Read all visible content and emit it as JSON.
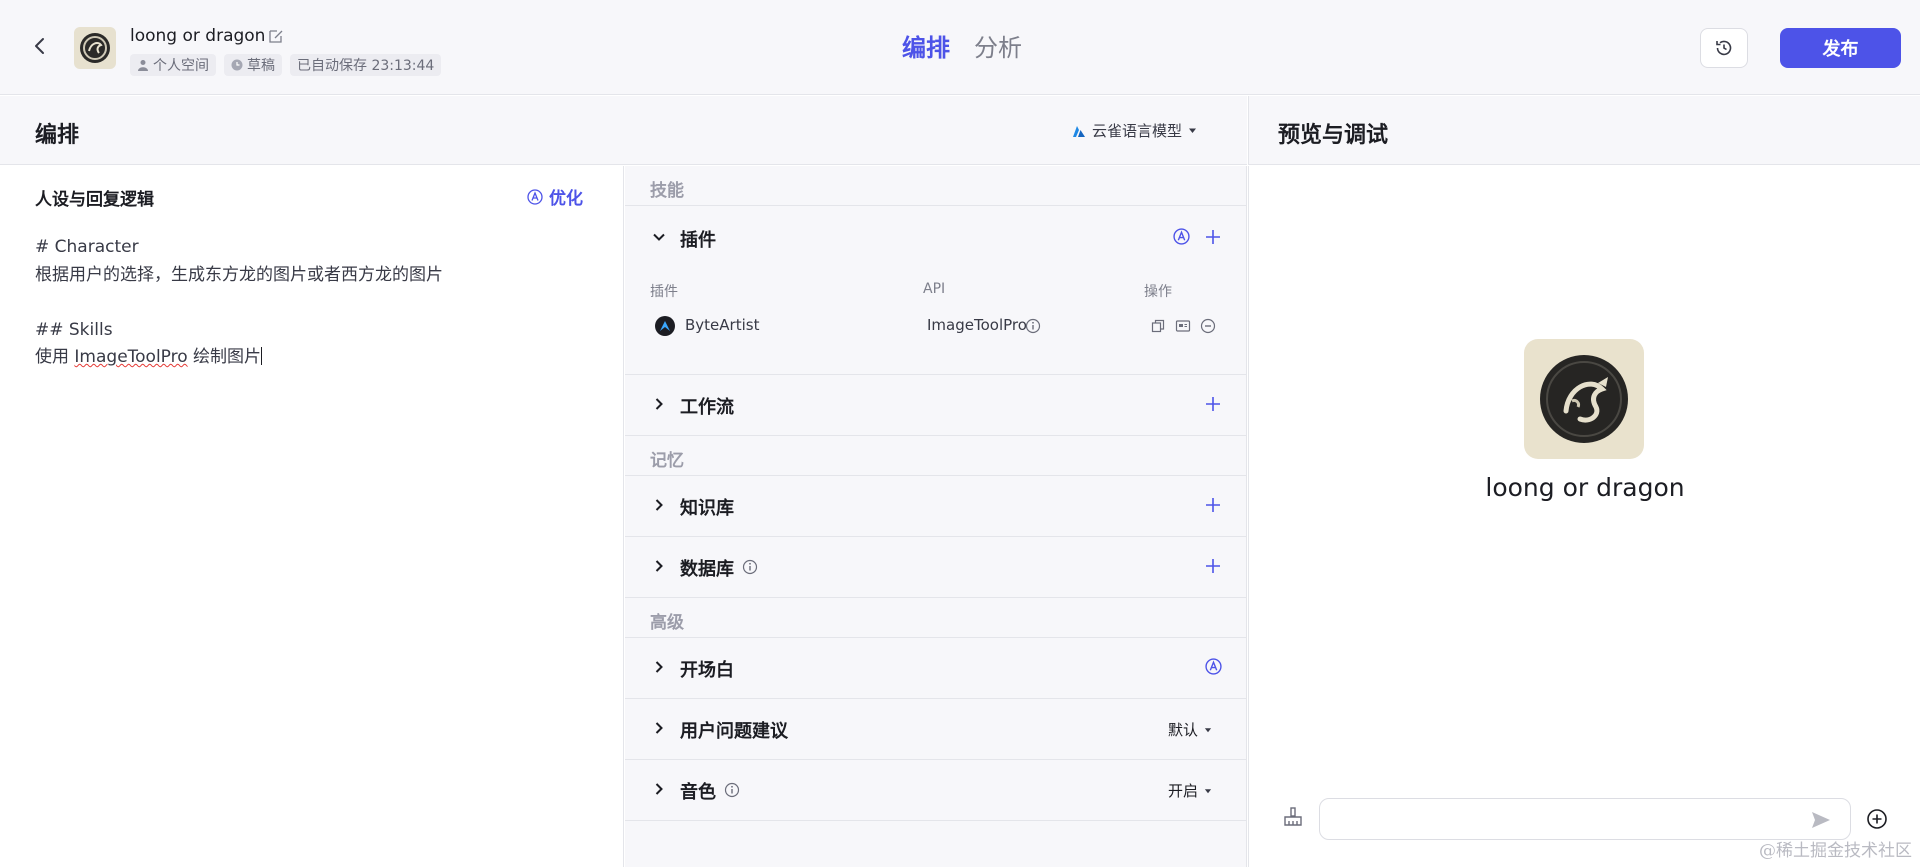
{
  "header": {
    "bot_name": "loong or dragon",
    "meta": {
      "space": "个人空间",
      "status": "草稿",
      "autosave": "已自动保存 23:13:44"
    },
    "tabs": [
      {
        "label": "编排",
        "active": true
      },
      {
        "label": "分析",
        "active": false
      }
    ],
    "publish_label": "发布",
    "accent_color": "#4d53e8"
  },
  "arrange": {
    "title": "编排",
    "model": "云雀语言模型"
  },
  "prompt": {
    "title": "人设与回复逻辑",
    "optimize_label": "优化",
    "lines": {
      "l1": "# Character",
      "l2": "根据用户的选择，生成东方龙的图片或者西方龙的图片",
      "l3": "## Skills",
      "l4_pre": "使用 ",
      "l4_word": "ImageToolPro",
      "l4_post": " 绘制图片"
    }
  },
  "skills": {
    "group_label": "技能",
    "plugins": {
      "label": "插件",
      "columns": {
        "plugin": "插件",
        "api": "API",
        "ops": "操作"
      },
      "items": [
        {
          "name": "ByteArtist",
          "api": "ImageToolPro"
        }
      ]
    },
    "workflow_label": "工作流"
  },
  "memory": {
    "group_label": "记忆",
    "knowledge_label": "知识库",
    "database_label": "数据库"
  },
  "advanced": {
    "group_label": "高级",
    "opening_label": "开场白",
    "suggestion_label": "用户问题建议",
    "suggestion_value": "默认",
    "voice_label": "音色",
    "voice_value": "开启"
  },
  "preview": {
    "title": "预览与调试",
    "bot_name": "loong or dragon",
    "input_placeholder": ""
  },
  "watermark": "@稀土掘金技术社区"
}
